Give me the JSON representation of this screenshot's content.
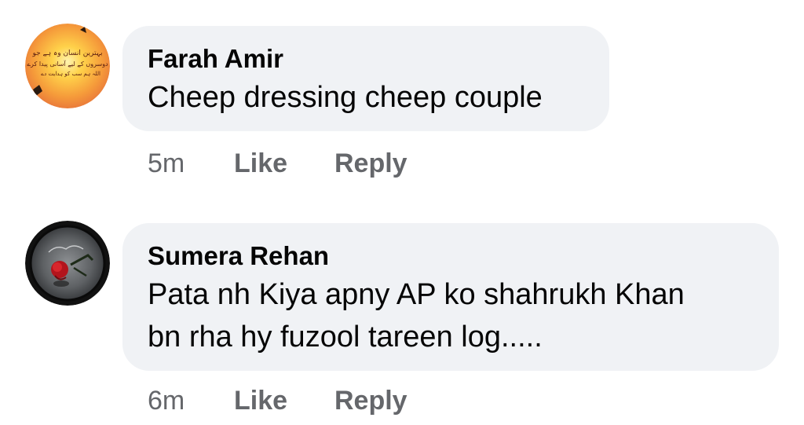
{
  "comments": [
    {
      "author": "Farah Amir",
      "text": "Cheep dressing cheep couple",
      "time": "5m",
      "like_label": "Like",
      "reply_label": "Reply",
      "avatar_icon": "calligraphy-sunset-avatar-icon",
      "avatar_calligraphy": [
        "بہترین انسان وہ ہے جو",
        "دوسروں کے لیے آسانی پیدا کرے",
        "اللہ ہم سب کو ہدایت دے"
      ]
    },
    {
      "author": "Sumera Rehan",
      "text_lines": [
        "Pata nh Kiya apny AP ko shahrukh Khan",
        "bn rha hy fuzool tareen log....."
      ],
      "time": "6m",
      "like_label": "Like",
      "reply_label": "Reply",
      "avatar_icon": "rose-on-stone-avatar-icon"
    }
  ],
  "colors": {
    "bubble_background": "#f0f2f5",
    "primary_text": "#050505",
    "secondary_text": "#65676b",
    "page_background": "#ffffff"
  }
}
